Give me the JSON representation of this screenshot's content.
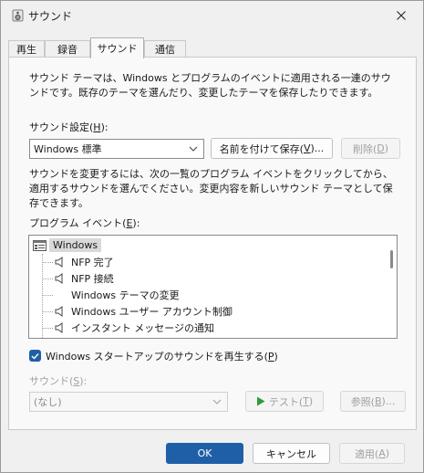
{
  "window": {
    "title": "サウンド",
    "close_icon": "close-icon"
  },
  "tabs": [
    {
      "label": "再生"
    },
    {
      "label": "録音"
    },
    {
      "label": "サウンド",
      "active": true
    },
    {
      "label": "通信"
    }
  ],
  "description": "サウンド テーマは、Windows とプログラムのイベントに適用される一連のサウンドです。既存のテーマを選んだり、変更したテーマを保存したりできます。",
  "scheme": {
    "label": "サウンド設定(",
    "access_key": "H",
    "label_end": "):",
    "selected": "Windows 標準",
    "save_as_button": "名前を付けて保存(",
    "save_as_key": "V",
    "save_as_end": ")...",
    "delete_button": "削除(",
    "delete_key": "D",
    "delete_end": ")"
  },
  "instructions": "サウンドを変更するには、次の一覧のプログラム イベントをクリックしてから、適用するサウンドを選んでください。変更内容を新しいサウンド テーマとして保存できます。",
  "events": {
    "label": "プログラム イベント(",
    "access_key": "E",
    "label_end": "):",
    "root": "Windows",
    "items": [
      {
        "label": "NFP 完了",
        "has_sound": true
      },
      {
        "label": "NFP 接続",
        "has_sound": true
      },
      {
        "label": "Windows テーマの変更",
        "has_sound": false
      },
      {
        "label": "Windows ユーザー アカウント制御",
        "has_sound": true
      },
      {
        "label": "インスタント メッセージの通知",
        "has_sound": true
      }
    ]
  },
  "startup": {
    "checked": true,
    "label": "Windows スタートアップのサウンドを再生する(",
    "access_key": "P",
    "label_end": ")"
  },
  "sounds": {
    "label": "サウンド(",
    "access_key": "S",
    "label_end": "):",
    "selected": "(なし)",
    "test_button": "テスト(",
    "test_key": "T",
    "test_end": ")",
    "browse_button": "参照(",
    "browse_key": "B",
    "browse_end": ")..."
  },
  "footer": {
    "ok": "OK",
    "cancel": "キャンセル",
    "apply": "適用(",
    "apply_key": "A",
    "apply_end": ")"
  },
  "colors": {
    "accent": "#1f5fa8",
    "play_green": "#2e9b3a"
  }
}
